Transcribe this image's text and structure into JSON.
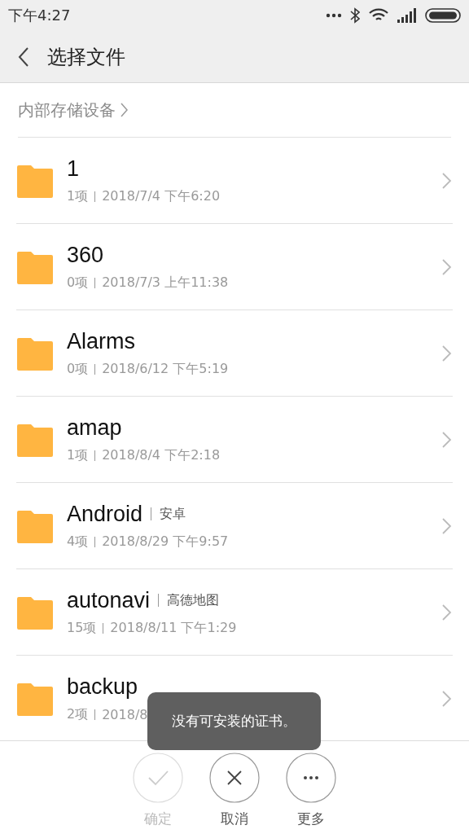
{
  "status_bar": {
    "time": "下午4:27"
  },
  "header": {
    "title": "选择文件"
  },
  "breadcrumb": {
    "label": "内部存储设备"
  },
  "folders": [
    {
      "name": "1",
      "count": "1项",
      "date": "2018/7/4 下午6:20"
    },
    {
      "name": "360",
      "count": "0项",
      "date": "2018/7/3 上午11:38"
    },
    {
      "name": "Alarms",
      "count": "0项",
      "date": "2018/6/12 下午5:19"
    },
    {
      "name": "amap",
      "count": "1项",
      "date": "2018/8/4 下午2:18"
    },
    {
      "name": "Android",
      "alias": "安卓",
      "count": "4项",
      "date": "2018/8/29 下午9:57"
    },
    {
      "name": "autonavi",
      "alias": "高德地图",
      "count": "15项",
      "date": "2018/8/11 下午1:29"
    },
    {
      "name": "backup",
      "count": "2项",
      "date": "2018/8"
    }
  ],
  "toast": "没有可安装的证书。",
  "actions": [
    {
      "kind": "confirm",
      "label": "确定",
      "disabled": true
    },
    {
      "kind": "cancel",
      "label": "取消",
      "disabled": false
    },
    {
      "kind": "more",
      "label": "更多",
      "disabled": false
    }
  ]
}
